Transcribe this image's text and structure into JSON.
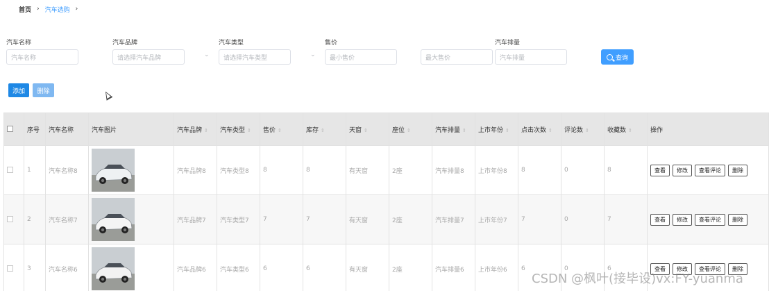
{
  "breadcrumb": {
    "home": "首页",
    "separator": "›",
    "current": "汽车选购"
  },
  "search": {
    "name": {
      "label": "汽车名称",
      "placeholder": "汽车名称"
    },
    "brand": {
      "label": "汽车品牌",
      "placeholder": "请选择汽车品牌"
    },
    "type": {
      "label": "汽车类型",
      "placeholder": "请选择汽车类型"
    },
    "price": {
      "label": "售价",
      "min_placeholder": "最小售价",
      "max_placeholder": "最大售价"
    },
    "displacement": {
      "label": "汽车排量",
      "placeholder": "汽车排量"
    },
    "button_label": "查询",
    "arrow": "⌄"
  },
  "toolbar": {
    "add_label": "添加",
    "delete_label": "删除"
  },
  "table": {
    "columns": [
      "序号",
      "汽车名称",
      "汽车图片",
      "汽车品牌",
      "汽车类型",
      "售价",
      "库存",
      "天窗",
      "座位",
      "汽车排量",
      "上市年份",
      "点击次数",
      "评论数",
      "收藏数",
      "操作"
    ],
    "sort_glyph": "⇕",
    "rows": [
      {
        "index": "1",
        "name": "汽车名称8",
        "brand": "汽车品牌8",
        "type": "汽车类型8",
        "price": "8",
        "stock": "8",
        "sunroof": "有天窗",
        "seats": "2座",
        "displacement": "汽车排量8",
        "year": "上市年份8",
        "clicks": "8",
        "comments": "0",
        "favorites": "8",
        "car_color": "#eef1f3"
      },
      {
        "index": "2",
        "name": "汽车名称7",
        "brand": "汽车品牌7",
        "type": "汽车类型7",
        "price": "7",
        "stock": "7",
        "sunroof": "有天窗",
        "seats": "2座",
        "displacement": "汽车排量7",
        "year": "上市年份7",
        "clicks": "7",
        "comments": "0",
        "favorites": "7",
        "car_color": "#f4f4f4"
      },
      {
        "index": "3",
        "name": "汽车名称6",
        "brand": "汽车品牌6",
        "type": "汽车类型6",
        "price": "6",
        "stock": "6",
        "sunroof": "有天窗",
        "seats": "2座",
        "displacement": "汽车排量6",
        "year": "上市年份6",
        "clicks": "6",
        "comments": "0",
        "favorites": "6",
        "car_color": "#f2f2f2"
      }
    ],
    "actions": {
      "view": "查看",
      "edit": "修改",
      "comments": "查看评论",
      "delete": "删除"
    }
  },
  "watermark": "CSDN @枫叶(接毕设)vx:FY-yuanma"
}
